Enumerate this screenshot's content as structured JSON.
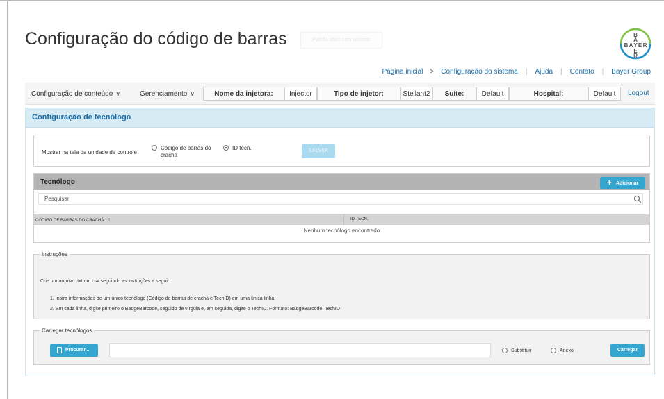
{
  "page": {
    "title": "Configuração do código de barras",
    "ghost_chip": "Padrão salvo com sucesso"
  },
  "logo": {
    "letters": [
      "B",
      "A",
      "Y",
      "E",
      "R"
    ]
  },
  "top_links": {
    "home": "Página inicial",
    "separator": ">",
    "system_config": "Configuração do sistema",
    "help": "Ajuda",
    "contact": "Contato",
    "bayer_group": "Bayer Group"
  },
  "navbar": {
    "content_config": "Configuração de conteúdo",
    "management": "Gerenciamento",
    "injector_name_label": "Nome da injetora:",
    "injector_name_value": "Injector",
    "injector_type_label": "Tipo de injetor:",
    "injector_type_value": "Stellant2",
    "suite_label": "Suíte:",
    "suite_value": "Default",
    "hospital_label": "Hospital:",
    "hospital_value": "Default",
    "logout": "Logout"
  },
  "panel": {
    "header": "Configuração de tecnólogo"
  },
  "settings": {
    "display_label": "Mostrar na tela da unidade de controle",
    "option_badge": "Código de barras do crachá",
    "option_id": "ID tecn.",
    "selected": "ID tecn.",
    "save_label": "SALVAR"
  },
  "technologist": {
    "title": "Tecnólogo",
    "add_label": "Adicionar",
    "search_placeholder": "Pesquisar",
    "columns": [
      "CÓDIGO DE BARRAS DO CRACHÁ",
      "ID TECN."
    ],
    "sort_indicator": "↑",
    "empty_message": "Nenhum tecnólogo encontrado"
  },
  "instructions": {
    "legend": "Instruções",
    "intro": "Crie um arquivo .txt ou .csv seguindo as instruções a seguir:",
    "items": [
      "1.  Insira informações de um único tecnólogo (Código de barras de crachá e TechID) em uma única linha.",
      "2.  Em cada linha, digite primeiro o BadgeBarcode, seguido de vírgula e, em seguida, digite o TechID. Formato: BadgeBarcode, TechID"
    ]
  },
  "upload": {
    "legend": "Carregar tecnólogos",
    "browse_label": "Procurar...",
    "file_value": "",
    "replace_label": "Substituir",
    "append_label": "Anexo",
    "upload_label": "Carregar"
  },
  "colors": {
    "accent": "#34a6d0",
    "link": "#1b6fa8",
    "panel_header_bg": "#d7ebf5",
    "tech_header_bg": "#b3b3b3",
    "logo_green": "#7ec342",
    "logo_blue": "#1f8ec9"
  }
}
